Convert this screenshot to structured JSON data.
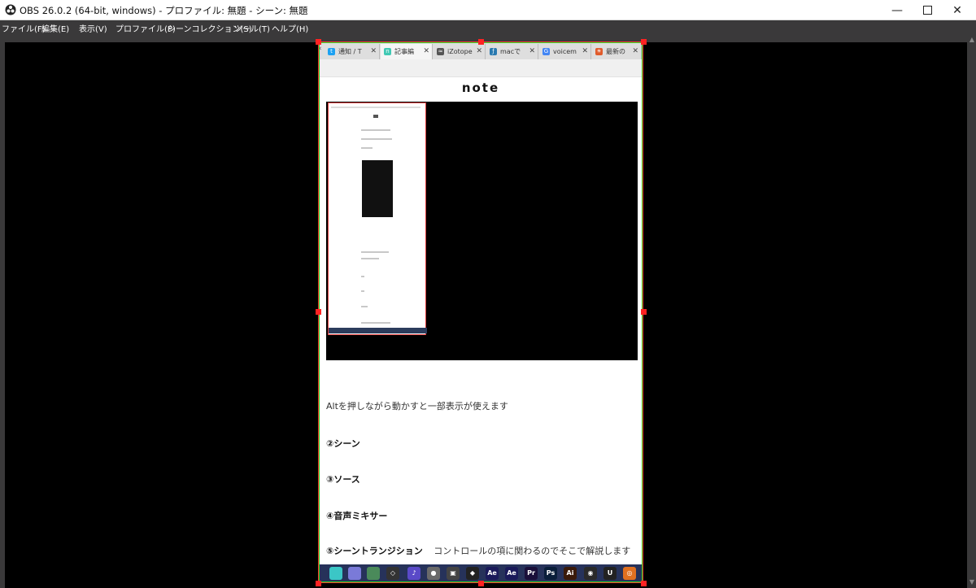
{
  "window": {
    "title": "OBS 26.0.2 (64-bit, windows) - プロファイル: 無題 - シーン: 無題"
  },
  "menu": [
    "ファイル(F)",
    "編集(E)",
    "表示(V)",
    "プロファイル(P)",
    "シーンコレクション(S)",
    "ツール(T)",
    "ヘルプ(H)"
  ],
  "browser": {
    "tabs": [
      {
        "label": "通知 / T",
        "icon": "twitter-icon",
        "color": "#1da1f2"
      },
      {
        "label": "記事編",
        "icon": "note-icon",
        "color": "#41c9b4"
      },
      {
        "label": "iZotope",
        "icon": "izotope-icon",
        "color": "#555555"
      },
      {
        "label": "macで",
        "icon": "feather-icon",
        "color": "#2a7ab0"
      },
      {
        "label": "voicem",
        "icon": "google-icon",
        "color": "#4285f4"
      },
      {
        "label": "最新の",
        "icon": "sun-icon",
        "color": "#e05a2a"
      }
    ],
    "logo": "note"
  },
  "article": {
    "text1": "Altを押しながら動かすと一部表示が使えます",
    "h2": "②シーン",
    "h3": "③ソース",
    "h4": "④音声ミキサー",
    "h5": "⑤シーントランジション",
    "h5_note": "コントロールの項に関わるのでそこで解説します"
  },
  "taskbar_apps": [
    {
      "icon": "hatsune-icon",
      "color": "#3bc6c6",
      "glyph": ""
    },
    {
      "icon": "character-icon",
      "color": "#7a7ad8",
      "glyph": ""
    },
    {
      "icon": "landscape-icon",
      "color": "#4a8a5a",
      "glyph": ""
    },
    {
      "icon": "unity-icon",
      "color": "#333333",
      "glyph": "◇"
    },
    {
      "icon": "music-icon",
      "color": "#5a4ac8",
      "glyph": "♪"
    },
    {
      "icon": "audio-icon",
      "color": "#6a6a6a",
      "glyph": "●"
    },
    {
      "icon": "cube-icon",
      "color": "#444444",
      "glyph": "▣"
    },
    {
      "icon": "unity-logo-icon",
      "color": "#222222",
      "glyph": "◆"
    },
    {
      "icon": "after-effects-icon",
      "color": "#1a1a5a",
      "glyph": "Ae"
    },
    {
      "icon": "after-effects-alt-icon",
      "color": "#1a1a5a",
      "glyph": "Ae"
    },
    {
      "icon": "premiere-icon",
      "color": "#1a0f3a",
      "glyph": "Pr"
    },
    {
      "icon": "photoshop-icon",
      "color": "#0a1e3a",
      "glyph": "Ps"
    },
    {
      "icon": "illustrator-icon",
      "color": "#3a1a0a",
      "glyph": "Ai"
    },
    {
      "icon": "obs-icon",
      "color": "#2a2a2a",
      "glyph": "◉"
    },
    {
      "icon": "unreal-icon",
      "color": "#222222",
      "glyph": "U"
    },
    {
      "icon": "blender-icon",
      "color": "#e07020",
      "glyph": "◎"
    }
  ]
}
